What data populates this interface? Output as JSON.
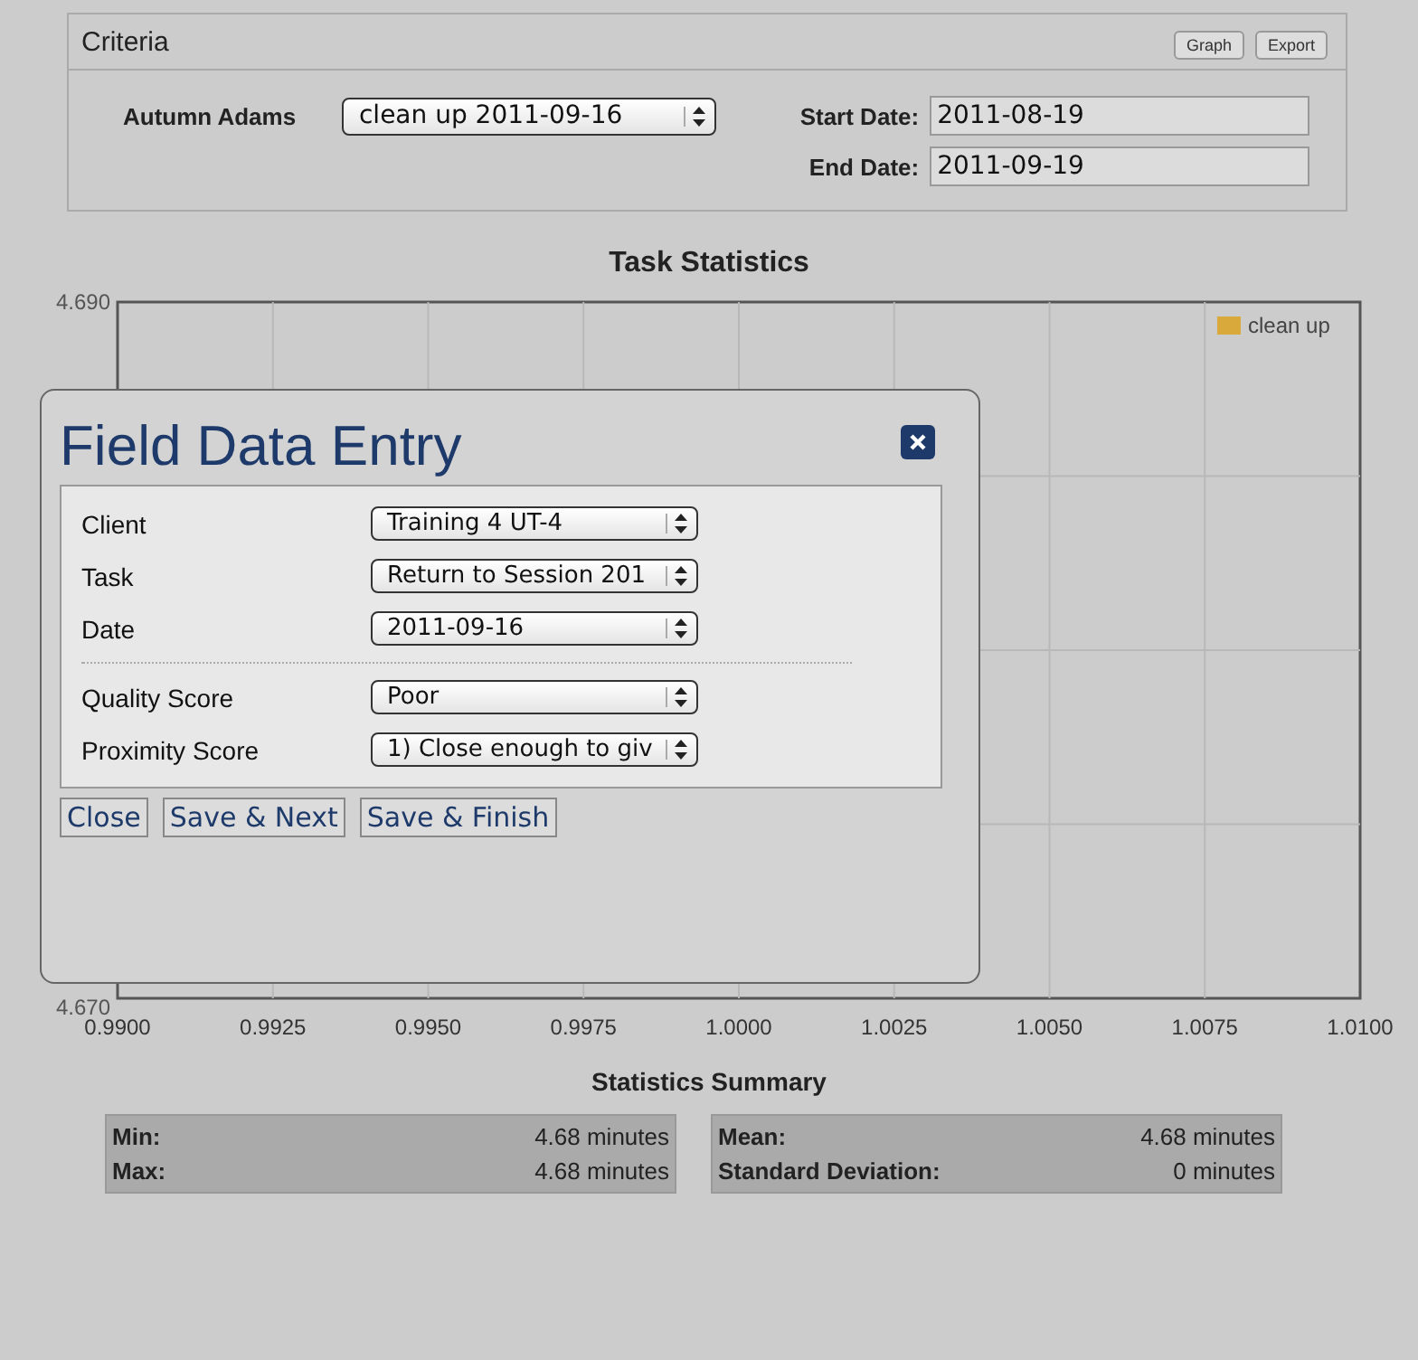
{
  "criteria": {
    "title": "Criteria",
    "buttons": [
      "Graph",
      "Export"
    ],
    "person": "Autumn Adams",
    "task_select": "clean up 2011-09-16",
    "start_date": {
      "label": "Start Date:",
      "value": "2011-08-19"
    },
    "end_date": {
      "label": "End Date:",
      "value": "2011-09-19"
    }
  },
  "chart": {
    "chart_data": {
      "type": "line",
      "title": "Task Statistics",
      "grid": true,
      "ylim": [
        4.67,
        4.69
      ],
      "categories": [
        "0.9900",
        "0.9925",
        "0.9950",
        "0.9975",
        "1.0000",
        "1.0025",
        "1.0050",
        "1.0075",
        "1.0100"
      ],
      "yticks": [
        {
          "value": 4.67,
          "label": "4.670"
        },
        {
          "value": 4.69,
          "label": "4.690"
        }
      ],
      "series": [
        {
          "name": "clean up",
          "color": "#d9a93b",
          "values": [
            null,
            null,
            null,
            null,
            null,
            null,
            null,
            null,
            null
          ]
        }
      ]
    }
  },
  "dialog": {
    "title": "Field Data Entry",
    "groups": [
      [
        {
          "label": "Client",
          "value": "Training 4 UT-4"
        },
        {
          "label": "Task",
          "value": "Return to Session 201"
        },
        {
          "label": "Date",
          "value": "2011-09-16"
        }
      ],
      [
        {
          "label": "Quality Score",
          "value": "Poor"
        },
        {
          "label": "Proximity Score",
          "value": "1) Close enough to giv"
        }
      ]
    ],
    "buttons": [
      "Close",
      "Save & Next",
      "Save & Finish"
    ]
  },
  "summary": {
    "title": "Statistics Summary",
    "boxes": [
      {
        "rows": [
          {
            "label": "Min:",
            "value": "4.68 minutes"
          },
          {
            "label": "Max:",
            "value": "4.68 minutes"
          }
        ]
      },
      {
        "rows": [
          {
            "label": "Mean:",
            "value": "4.68 minutes"
          },
          {
            "label": "Standard Deviation:",
            "value": "0 minutes"
          }
        ]
      }
    ]
  }
}
